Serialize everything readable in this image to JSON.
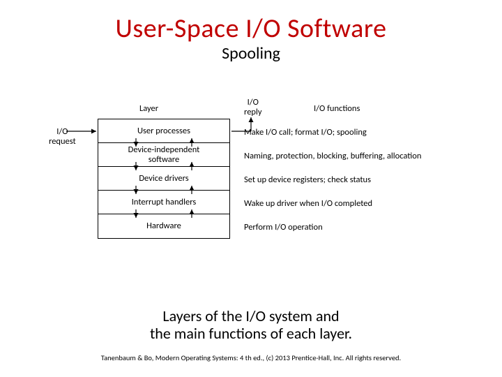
{
  "title": "User-Space I/O Software",
  "subtitle": "Spooling",
  "labels": {
    "layer": "Layer",
    "io_reply": "I/O\nreply",
    "io_functions": "I/O functions",
    "io_request": "I/O\nrequest"
  },
  "layers": [
    {
      "name": "User processes",
      "func": "Make I/O call; format I/O; spooling"
    },
    {
      "name": "Device-independent software",
      "func": "Naming, protection, blocking, buffering, allocation"
    },
    {
      "name": "Device drivers",
      "func": "Set up device registers; check status"
    },
    {
      "name": "Interrupt handlers",
      "func": "Wake up driver when I/O completed"
    },
    {
      "name": "Hardware",
      "func": "Perform I/O operation"
    }
  ],
  "caption_line1": "Layers of the I/O system and",
  "caption_line2": "the main functions of each layer.",
  "footer": "Tanenbaum & Bo, Modern Operating Systems: 4 th ed., (c) 2013 Prentice-Hall, Inc. All rights reserved."
}
